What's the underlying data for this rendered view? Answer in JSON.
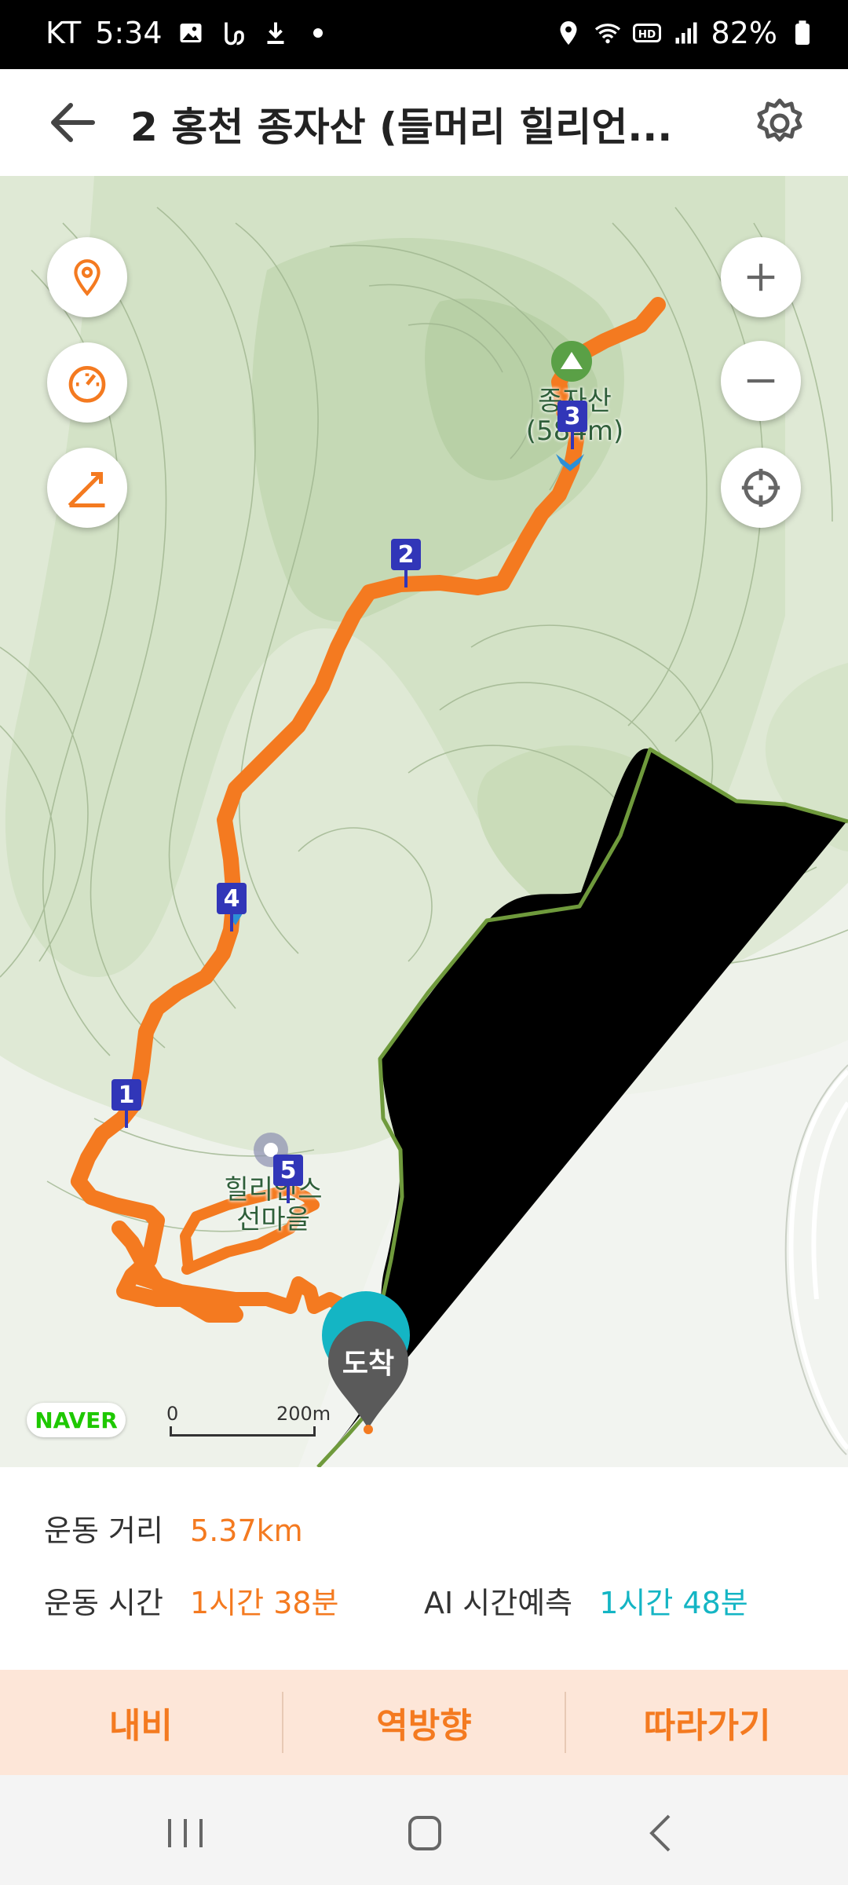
{
  "status_bar": {
    "carrier": "KT",
    "time": "5:34",
    "battery": "82%",
    "icons": [
      "image-icon",
      "b-app-icon",
      "download-icon",
      "dot-icon",
      "location-icon",
      "wifi-icon",
      "hd-icon",
      "signal-icon",
      "battery-icon"
    ]
  },
  "header": {
    "title": "2 홍천 종자산 (들머리 힐리언...",
    "back_icon": "arrow-left-icon",
    "settings_icon": "gear-icon"
  },
  "map": {
    "peak_label_line1": "종자산",
    "peak_label_line2": "(584m)",
    "place_label_line1": "힐리언스",
    "place_label_line2": "선마을",
    "waypoints": [
      "1",
      "2",
      "3",
      "4",
      "5"
    ],
    "arrival_label": "도착",
    "naver_logo": "NAVER",
    "scale_zero": "0",
    "scale_distance": "200m",
    "controls": {
      "left": [
        "location-pin-icon",
        "speedometer-icon",
        "elevation-icon"
      ],
      "right": [
        "zoom-in-icon",
        "zoom-out-icon",
        "crosshair-icon"
      ]
    },
    "colors": {
      "route": "#f47a20",
      "trail": "#6f9a3c",
      "waypoint": "#3136b8",
      "arrival": "#5a5a5a",
      "teal": "#14b5c4"
    }
  },
  "stats": {
    "distance_label": "운동 거리",
    "distance_value": "5.37km",
    "time_label": "운동 시간",
    "time_value": "1시간 38분",
    "ai_label": "AI 시간예측",
    "ai_value": "1시간 48분"
  },
  "actions": {
    "navigate": "내비",
    "reverse": "역방향",
    "follow": "따라가기"
  },
  "nav_bar": {
    "icons": [
      "recent-apps-icon",
      "home-icon",
      "back-nav-icon"
    ]
  }
}
